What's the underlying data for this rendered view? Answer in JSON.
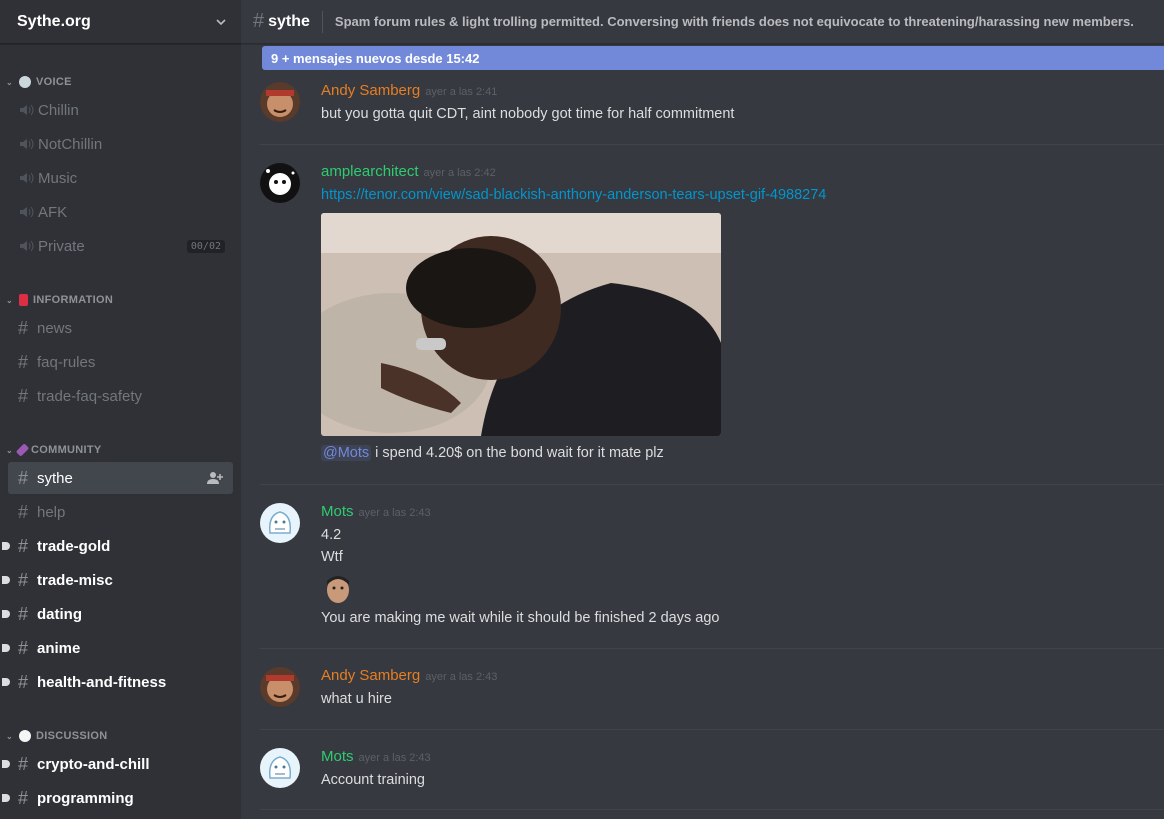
{
  "server": {
    "name": "Sythe.org"
  },
  "categories": {
    "voice": "VOICE",
    "information": "INFORMATION",
    "community": "COMMUNITY",
    "discussion": "DISCUSSION"
  },
  "voice_channels": [
    "Chillin",
    "NotChillin",
    "Music",
    "AFK",
    "Private"
  ],
  "voice_private_limit": "00/02",
  "info_channels": [
    "news",
    "faq-rules",
    "trade-faq-safety"
  ],
  "community_channels": [
    "sythe",
    "help",
    "trade-gold",
    "trade-misc",
    "dating",
    "anime",
    "health-and-fitness"
  ],
  "discussion_channels": [
    "crypto-and-chill",
    "programming"
  ],
  "topbar": {
    "channel": "sythe",
    "topic": "Spam forum rules & light trolling permitted. Conversing with friends does not equivocate to threatening/harassing new members."
  },
  "new_messages_bar": "9 + mensajes nuevos desde 15:42",
  "messages": [
    {
      "author": "Andy Samberg",
      "time": "ayer a las 2:41",
      "lines": [
        "but you gotta quit CDT, aint nobody got time for half commitment"
      ]
    },
    {
      "author": "amplearchitect",
      "time": "ayer a las 2:42",
      "link": "https://tenor.com/view/sad-blackish-anthony-anderson-tears-upset-gif-4988274",
      "mention": "@Mots",
      "after_mention": " i spend 4.20$ on the bond wait for it mate plz"
    },
    {
      "author": "Mots",
      "time": "ayer a las 2:43",
      "lines": [
        "4.2",
        "Wtf",
        "You are making me wait while it should be finished 2 days ago"
      ]
    },
    {
      "author": "Andy Samberg",
      "time": "ayer a las 2:43",
      "lines": [
        "what u hire"
      ]
    },
    {
      "author": "Mots",
      "time": "ayer a las 2:43",
      "lines": [
        "Account training"
      ]
    }
  ],
  "colors": {
    "accent": "#7289da",
    "author_orange": "#e67e22",
    "author_green": "#2ecc71",
    "link": "#0096cf"
  },
  "icons": [
    "chevron-down-icon",
    "speaker-icon",
    "hash-icon",
    "add-member-icon"
  ]
}
